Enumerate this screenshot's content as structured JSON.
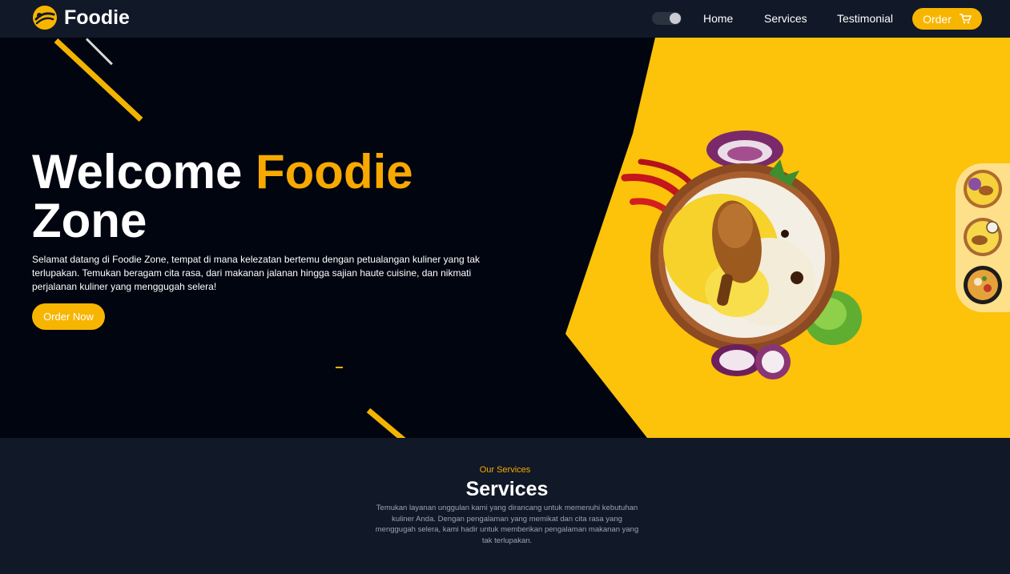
{
  "brand": {
    "name": "Foodie",
    "logo_icon": "fork-spoon-logo-icon"
  },
  "nav": {
    "theme_toggle_icon": "theme-toggle-icon",
    "home": "Home",
    "services": "Services",
    "testimonial": "Testimonial",
    "order_label": "Order",
    "order_icon": "cart-icon"
  },
  "hero": {
    "title_part1": "Welcome ",
    "title_accent": "Foodie",
    "title_part2": "Zone",
    "description": "Selamat datang di Foodie Zone, tempat di mana kelezatan bertemu dengan petualangan kuliner yang tak terlupakan. Temukan beragam cita rasa, dari makanan jalanan hingga sajian haute cuisine, dan nikmati perjalanan kuliner yang menggugah selera!",
    "cta": "Order Now"
  },
  "services": {
    "eyebrow": "Our Services",
    "title": "Services",
    "description": "Temukan layanan unggulan kami yang dirancang untuk memenuhi kebutuhan kuliner Anda. Dengan pengalaman yang memikat dan cita rasa yang menggugah selera, kami hadir untuk memberikan pengalaman makanan yang tak terlupakan."
  },
  "colors": {
    "accent": "#f8b500",
    "hero_bg": "#010510",
    "nav_bg": "#111827",
    "panel_yellow": "#fdc20a"
  }
}
